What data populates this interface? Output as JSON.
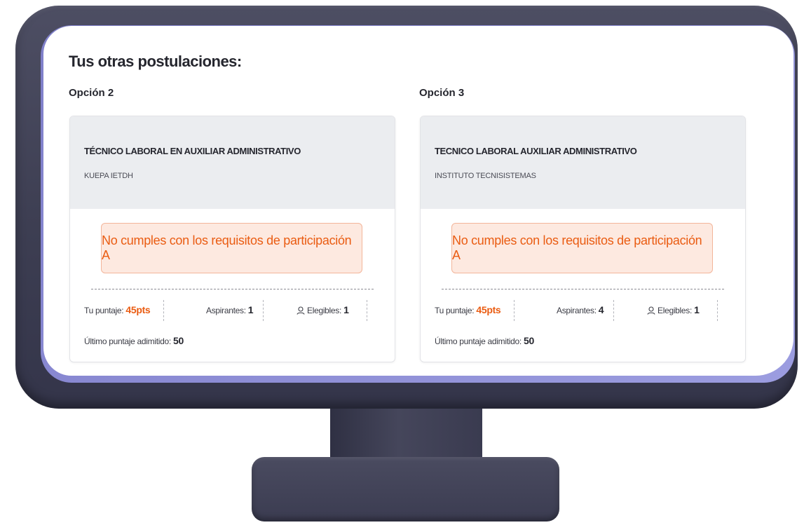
{
  "page_title": "Tus otras postulaciones:",
  "options": [
    {
      "label": "Opción 2",
      "program": "TÉCNICO LABORAL EN AUXILIAR ADMINISTRATIVO",
      "institution": "KUEPA IETDH",
      "warning": "No cumples con los requisitos de participación A",
      "score_label": "Tu puntaje:",
      "score_value": "45pts",
      "applicants_label": "Aspirantes:",
      "applicants_value": "1",
      "eligible_label": "Elegibles:",
      "eligible_value": "1",
      "last_score_label": "Último puntaje adimitido:",
      "last_score_value": "50"
    },
    {
      "label": "Opción 3",
      "program": "TECNICO LABORAL AUXILIAR ADMINISTRATIVO",
      "institution": "INSTITUTO TECNISISTEMAS",
      "warning": "No cumples con los requisitos de participación A",
      "score_label": "Tu puntaje:",
      "score_value": "45pts",
      "applicants_label": "Aspirantes:",
      "applicants_value": "4",
      "eligible_label": "Elegibles:",
      "eligible_value": "1",
      "last_score_label": "Último puntaje adimitido:",
      "last_score_value": "50"
    }
  ],
  "colors": {
    "accent_orange": "#ea5c12",
    "warning_bg": "#fde9e0",
    "card_header_bg": "#ebedf0",
    "monitor_frame": "#3d3e52",
    "bezel_glow": "#8a8ad3"
  }
}
